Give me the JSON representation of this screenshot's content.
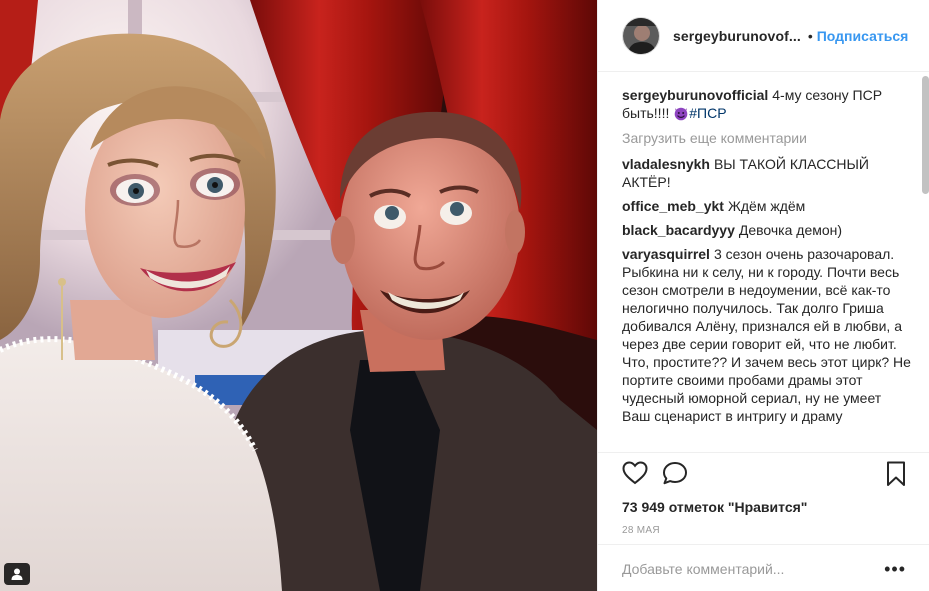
{
  "post": {
    "username": "sergeyburunovof...",
    "follow_label": "Подписаться",
    "dot": "•"
  },
  "caption": {
    "username": "sergeyburunovofficial",
    "text": "4-му сезону ПСР быть!!!!",
    "hashtag": "#ПСР",
    "emoji": "smiling-devil-emoji"
  },
  "load_more_label": "Загрузить еще комментарии",
  "comments": [
    {
      "username": "vladalesnykh",
      "text": "ВЫ ТАКОЙ КЛАССНЫЙ АКТЁР!"
    },
    {
      "username": "office_meb_ykt",
      "text": "Ждём ждём"
    },
    {
      "username": "black_bacardyyy",
      "text": "Девочка демон)"
    },
    {
      "username": "varyasquirrel",
      "text": "3 сезон очень разочаровал. Рыбкина ни к селу, ни к городу. Почти весь сезон смотрели в недоумении, всё как-то нелогично получилось. Так долго Гриша добивался Алёну, признался ей в любви, а через две серии говорит ей, что не любит. Что, простите?? И зачем весь этот цирк? Не портите своими пробами драмы этот чудесный юморной сериал, ну не умеет Ваш сценарист в интригу и драму"
    }
  ],
  "likes_text": "73 949 отметок \"Нравится\"",
  "date": "28 мая",
  "add_comment_placeholder": "Добавьте комментарий...",
  "more_label": "•••",
  "icons": {
    "like": "heart-icon",
    "comment": "speech-bubble-icon",
    "save": "bookmark-icon",
    "user_tag": "person-tag-icon"
  },
  "colors": {
    "link_blue": "#3897f0",
    "hashtag": "#003569",
    "muted": "#999999",
    "text": "#262626"
  }
}
